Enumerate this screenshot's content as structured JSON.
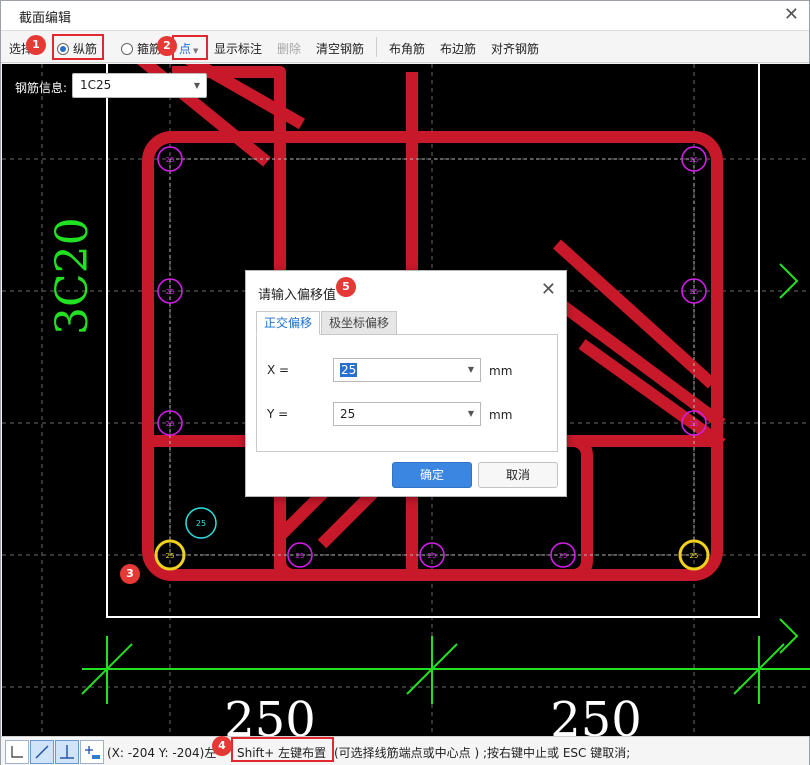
{
  "window": {
    "title": "截面编辑",
    "close_glyph": "✕"
  },
  "toolbar": {
    "select_label": "选择",
    "longitudinal_label": "纵筋",
    "stirrup_label": "箍筋",
    "mode_label": "点",
    "show_annotation": "显示标注",
    "delete": "删除",
    "clear_rebar": "清空钢筋",
    "corner_rebar": "布角筋",
    "edge_rebar": "布边筋",
    "align_rebar": "对齐钢筋"
  },
  "rebar_info": {
    "label": "钢筋信息:",
    "value": "1C25"
  },
  "drawing": {
    "side_label": "3C20",
    "dim_left": "250",
    "dim_right": "250",
    "bar_label": "25",
    "colors": {
      "concrete_rebar": "#c8192b",
      "bar_circle": "#d21ee6",
      "selected_bar": "#f0d21e",
      "cursor_bar": "#2fe0e0",
      "dimension": "#22e022",
      "outline": "#ffffff"
    }
  },
  "dialog": {
    "title": "请输入偏移值",
    "tab_ortho": "正交偏移",
    "tab_polar": "极坐标偏移",
    "x_label": "X =",
    "x_value": "25",
    "y_label": "Y =",
    "y_value": "25",
    "unit": "mm",
    "ok": "确定",
    "cancel": "取消"
  },
  "statusbar": {
    "coords": "(X: -204 Y: -204)左",
    "hint_key": "Shift+ 左键布置",
    "hint_rest": "(可选择线筋端点或中心点 ) ;按右键中止或 ESC 键取消;"
  },
  "badges": [
    "1",
    "2",
    "3",
    "4",
    "5"
  ]
}
